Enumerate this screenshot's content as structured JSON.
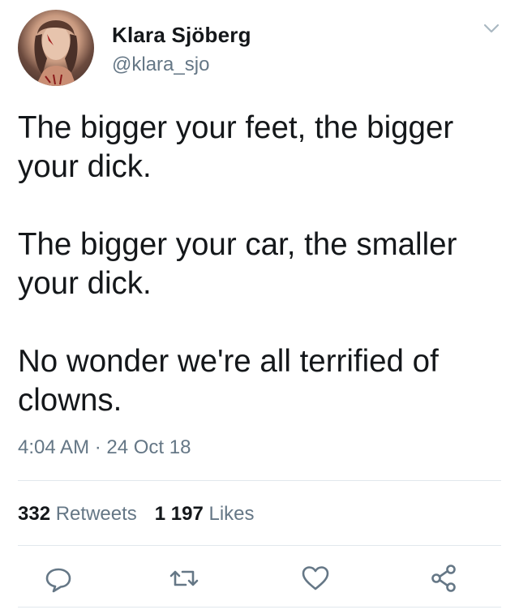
{
  "author": {
    "display_name": "Klara Sjöberg",
    "handle": "@klara_sjo"
  },
  "tweet": {
    "paragraphs": [
      "The bigger your feet, the bigger your dick.",
      "The bigger your car, the smaller your dick.",
      "No wonder we're all terrified of clowns."
    ],
    "timestamp": "4:04 AM · 24 Oct 18"
  },
  "stats": {
    "retweets_count": "332",
    "retweets_label": "Retweets",
    "likes_count": "1 197",
    "likes_label": "Likes"
  },
  "icons": {
    "menu": "chevron-down-icon",
    "reply": "reply-icon",
    "retweet": "retweet-icon",
    "like": "heart-icon",
    "share": "share-icon"
  },
  "colors": {
    "text": "#14171a",
    "secondary": "#657786",
    "divider": "#e1e8ed"
  }
}
